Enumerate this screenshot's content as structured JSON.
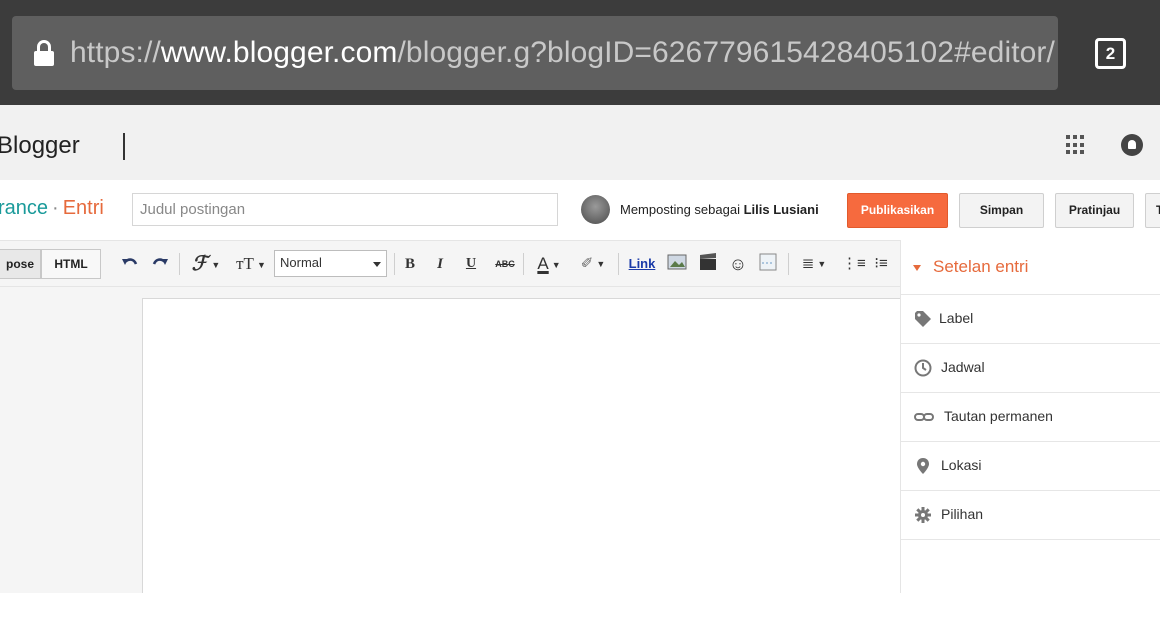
{
  "browser": {
    "url_scheme": "https://",
    "url_host": "www.blogger.com",
    "url_path": "/blogger.g?blogID=626779615428405102#editor/",
    "tab_count": "2"
  },
  "header": {
    "logo_text": "Blogger"
  },
  "postbar": {
    "breadcrumb_blog": "rance",
    "breadcrumb_sep": "·",
    "breadcrumb_section": "Entri",
    "title_placeholder": "Judul postingan",
    "posting_as_prefix": "Memposting sebagai",
    "posting_as_user": "Lilis Lusiani",
    "publish_label": "Publikasikan",
    "save_label": "Simpan",
    "preview_label": "Pratinjau",
    "close_label": "T"
  },
  "toolbar": {
    "mode_compose": "pose",
    "mode_html": "HTML",
    "format_value": "Normal",
    "link_label": "Link"
  },
  "sidebar": {
    "heading": "Setelan entri",
    "items": [
      {
        "label": "Label",
        "icon": "tag-icon"
      },
      {
        "label": "Jadwal",
        "icon": "clock-icon"
      },
      {
        "label": "Tautan permanen",
        "icon": "link-icon"
      },
      {
        "label": "Lokasi",
        "icon": "location-pin-icon"
      },
      {
        "label": "Pilihan",
        "icon": "gear-icon"
      }
    ]
  },
  "colors": {
    "accent_orange": "#f66a3e",
    "teal": "#1a9a9a"
  }
}
